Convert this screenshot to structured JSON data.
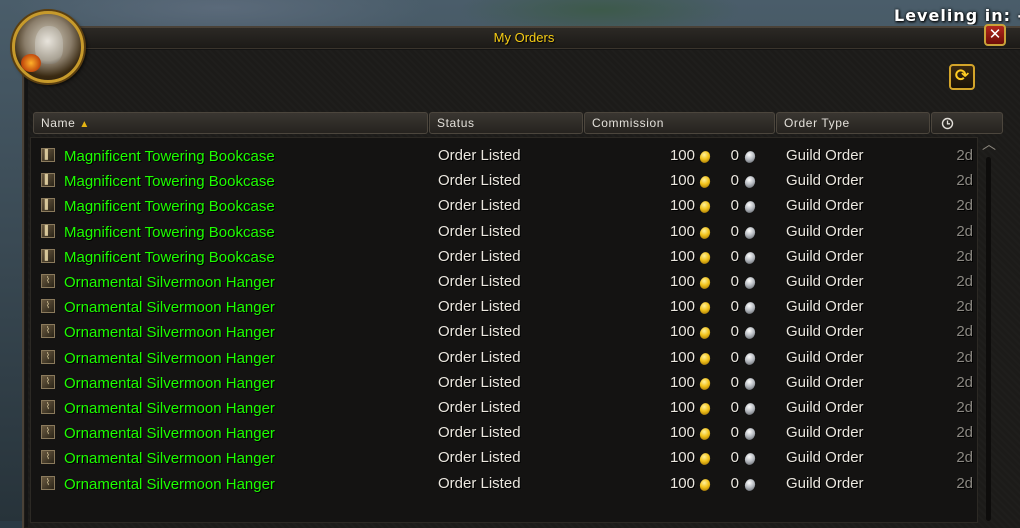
{
  "hud": {
    "leveling_label": "Leveling in: --"
  },
  "window": {
    "title": "My Orders",
    "close_label": "✕",
    "refresh_label": "⟳"
  },
  "columns": {
    "name": "Name",
    "status": "Status",
    "commission": "Commission",
    "order_type": "Order Type",
    "time_icon": "clock-icon"
  },
  "sort_indicator": "▲",
  "orders": [
    {
      "name": "Magnificent Towering Bookcase",
      "status": "Order Listed",
      "gold": "100",
      "silver": "0",
      "order_type": "Guild Order",
      "time": "2d"
    },
    {
      "name": "Magnificent Towering Bookcase",
      "status": "Order Listed",
      "gold": "100",
      "silver": "0",
      "order_type": "Guild Order",
      "time": "2d"
    },
    {
      "name": "Magnificent Towering Bookcase",
      "status": "Order Listed",
      "gold": "100",
      "silver": "0",
      "order_type": "Guild Order",
      "time": "2d"
    },
    {
      "name": "Magnificent Towering Bookcase",
      "status": "Order Listed",
      "gold": "100",
      "silver": "0",
      "order_type": "Guild Order",
      "time": "2d"
    },
    {
      "name": "Magnificent Towering Bookcase",
      "status": "Order Listed",
      "gold": "100",
      "silver": "0",
      "order_type": "Guild Order",
      "time": "2d"
    },
    {
      "name": "Ornamental Silvermoon Hanger",
      "status": "Order Listed",
      "gold": "100",
      "silver": "0",
      "order_type": "Guild Order",
      "time": "2d"
    },
    {
      "name": "Ornamental Silvermoon Hanger",
      "status": "Order Listed",
      "gold": "100",
      "silver": "0",
      "order_type": "Guild Order",
      "time": "2d"
    },
    {
      "name": "Ornamental Silvermoon Hanger",
      "status": "Order Listed",
      "gold": "100",
      "silver": "0",
      "order_type": "Guild Order",
      "time": "2d"
    },
    {
      "name": "Ornamental Silvermoon Hanger",
      "status": "Order Listed",
      "gold": "100",
      "silver": "0",
      "order_type": "Guild Order",
      "time": "2d"
    },
    {
      "name": "Ornamental Silvermoon Hanger",
      "status": "Order Listed",
      "gold": "100",
      "silver": "0",
      "order_type": "Guild Order",
      "time": "2d"
    },
    {
      "name": "Ornamental Silvermoon Hanger",
      "status": "Order Listed",
      "gold": "100",
      "silver": "0",
      "order_type": "Guild Order",
      "time": "2d"
    },
    {
      "name": "Ornamental Silvermoon Hanger",
      "status": "Order Listed",
      "gold": "100",
      "silver": "0",
      "order_type": "Guild Order",
      "time": "2d"
    },
    {
      "name": "Ornamental Silvermoon Hanger",
      "status": "Order Listed",
      "gold": "100",
      "silver": "0",
      "order_type": "Guild Order",
      "time": "2d"
    },
    {
      "name": "Ornamental Silvermoon Hanger",
      "status": "Order Listed",
      "gold": "100",
      "silver": "0",
      "order_type": "Guild Order",
      "time": "2d"
    }
  ],
  "colors": {
    "title": "#f7cd14",
    "item_name": "#1eff00",
    "text": "#ebe7df",
    "time": "#8b8882"
  }
}
